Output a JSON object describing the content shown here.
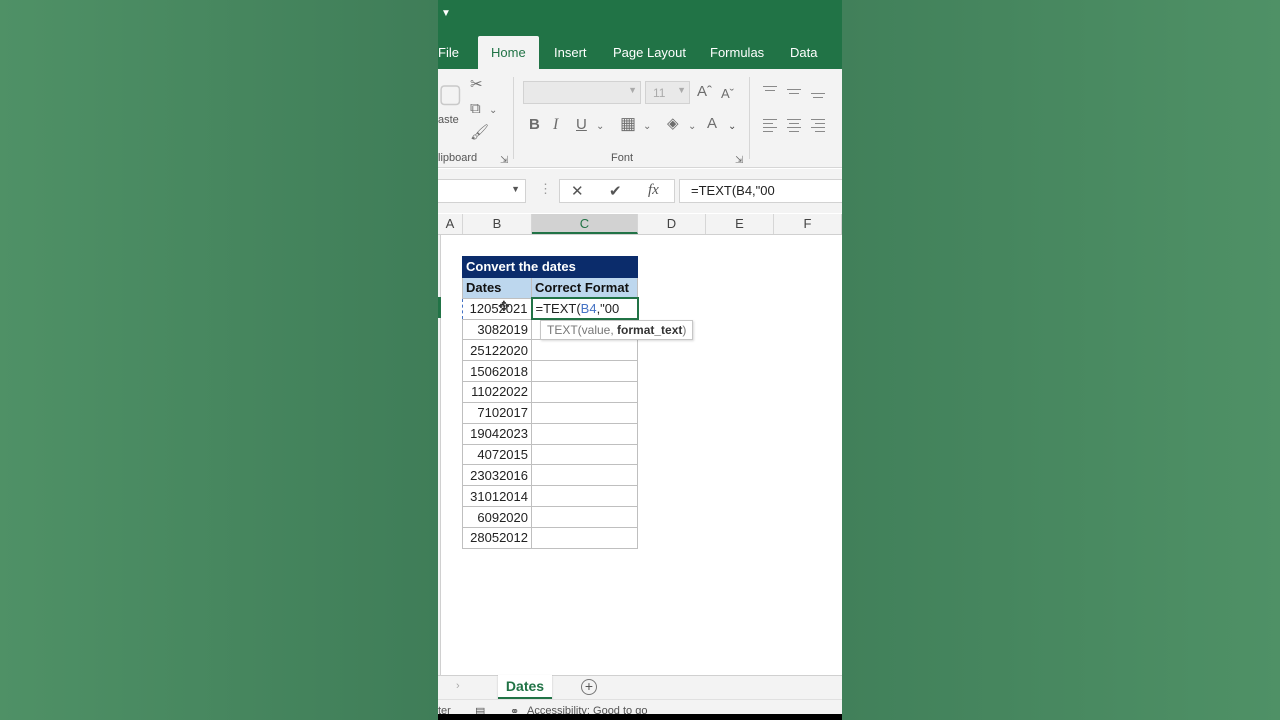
{
  "colors": {
    "excel_green": "#217346",
    "title_navy": "#0b2c6b",
    "header_blue": "#bdd7ee",
    "ref_blue": "#4472c4"
  },
  "ribbon": {
    "tabs": [
      {
        "label": "File",
        "active": false
      },
      {
        "label": "Home",
        "active": true
      },
      {
        "label": "Insert",
        "active": false
      },
      {
        "label": "Page Layout",
        "active": false
      },
      {
        "label": "Formulas",
        "active": false
      },
      {
        "label": "Data",
        "active": false
      }
    ],
    "clipboard": {
      "paste_label": "aste",
      "group_label": "lipboard"
    },
    "font": {
      "font_name": "",
      "font_size": "11",
      "group_label": "Font"
    }
  },
  "formula_bar": {
    "name_box": "",
    "formula": "=TEXT(B4,\"00"
  },
  "columns": [
    "A",
    "B",
    "C",
    "D",
    "E",
    "F"
  ],
  "selected_column": "C",
  "table": {
    "title": "Convert the dates",
    "headers": [
      "Dates",
      "Correct Format"
    ],
    "editing_value": {
      "prefix": "=TEXT(",
      "ref": "B4",
      "suffix": ",\"00"
    },
    "dates": [
      "12052021",
      "3082019",
      "25122020",
      "15062018",
      "11022022",
      "7102017",
      "19042023",
      "4072015",
      "23032016",
      "31012014",
      "6092020",
      "28052012"
    ]
  },
  "tooltip": {
    "fn": "TEXT(value, ",
    "arg": "format_text",
    "close": ")"
  },
  "sheets": {
    "active": "Dates"
  },
  "status": {
    "left": "ter",
    "accessibility": "Accessibility: Good to go"
  }
}
